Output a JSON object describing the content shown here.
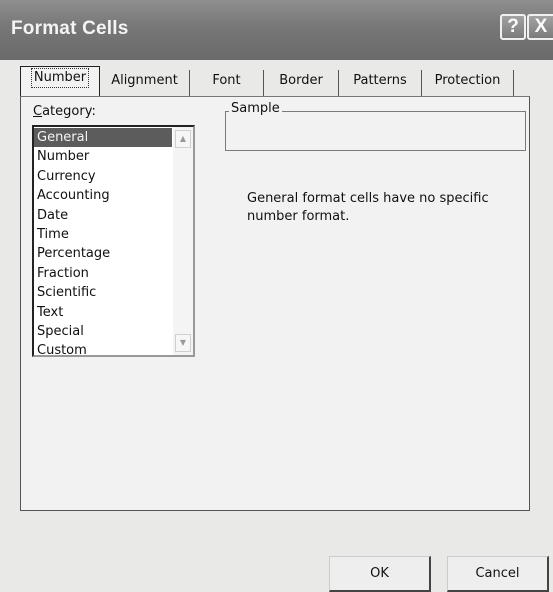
{
  "window": {
    "title": "Format Cells",
    "help_glyph": "?",
    "close_glyph": "X"
  },
  "tabs": [
    {
      "label": "Number",
      "active": true
    },
    {
      "label": "Alignment",
      "active": false
    },
    {
      "label": "Font",
      "active": false
    },
    {
      "label": "Border",
      "active": false
    },
    {
      "label": "Patterns",
      "active": false
    },
    {
      "label": "Protection",
      "active": false
    }
  ],
  "category": {
    "label_accel": "C",
    "label_rest": "ategory:",
    "selected": "General",
    "items": [
      "General",
      "Number",
      "Currency",
      "Accounting",
      "Date",
      "Time",
      "Percentage",
      "Fraction",
      "Scientific",
      "Text",
      "Special",
      "Custom"
    ]
  },
  "sample": {
    "legend": "Sample",
    "value": ""
  },
  "description": "General format cells have no specific number format.",
  "buttons": {
    "ok": "OK",
    "cancel": "Cancel"
  },
  "icons": {
    "scroll_up": "scroll-up-arrow-icon",
    "scroll_down": "scroll-down-arrow-icon"
  }
}
